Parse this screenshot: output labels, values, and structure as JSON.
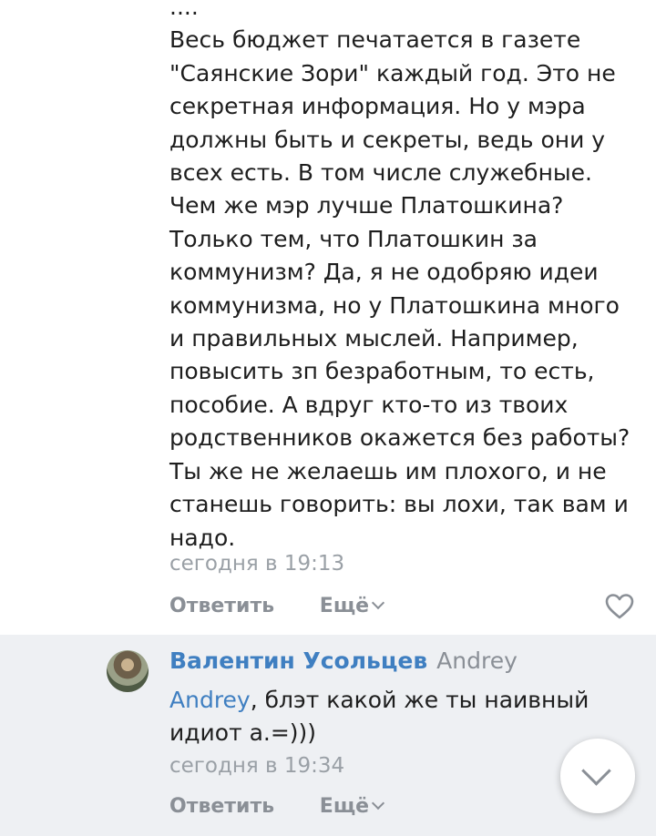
{
  "comment1": {
    "lines": [
      "....",
      "Весь бюджет печатается в газете",
      "\"Саянские Зори\" каждый год. Это не",
      "секретная информация. Но у мэра",
      "должны быть и секреты, ведь они у",
      "всех есть. В том числе служебные.",
      "Чем же мэр лучше Платошкина?",
      "Только тем, что Платошкин за",
      "коммунизм? Да, я не одобряю идеи",
      "коммунизма, но у Платошкина много",
      "и правильных мыслей. Например,",
      "повысить зп безработным, то есть,",
      "пособие. А вдруг кто-то из твоих",
      "родственников окажется без работы?",
      "Ты же не желаешь им плохого, и не",
      "станешь говорить: вы лохи, так вам и",
      "надо."
    ],
    "time": "сегодня в 19:13",
    "reply_label": "Ответить",
    "more_label": "Ещё"
  },
  "comment2": {
    "author": "Валентин Усольцев",
    "reply_to": "Andrey",
    "mention": "Andrey",
    "line1_rest": ", блэт какой же ты наивный",
    "line2": "идиот а.=)))",
    "time": "сегодня в 19:34",
    "reply_label": "Ответить",
    "more_label": "Ещё"
  },
  "icons": {
    "like": "heart-outline-icon",
    "scroll": "chevron-down-icon",
    "more": "chevron-down-icon"
  },
  "colors": {
    "link": "#3f7fc1",
    "muted": "#8a8f96",
    "highlight_bg": "#eef0f3"
  }
}
